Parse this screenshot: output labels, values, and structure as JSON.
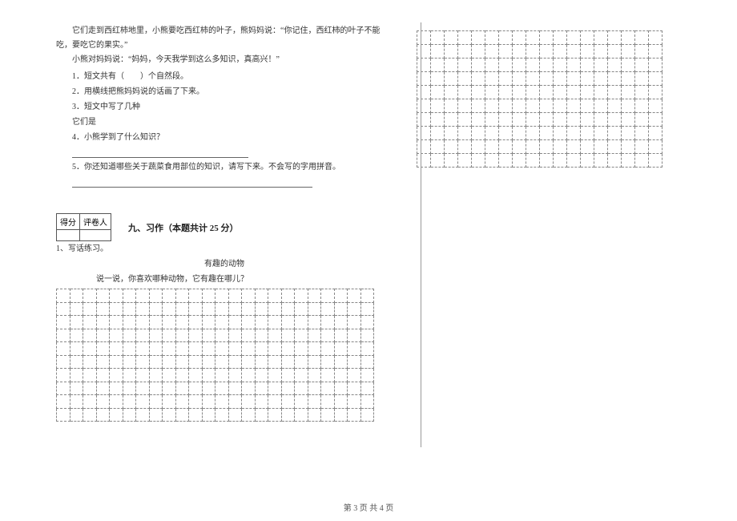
{
  "passage": {
    "p1": "它们走到西红柿地里，小熊要吃西红柿的叶子，熊妈妈说：“你记住，西红柿的叶子不能吃，要吃它的果实。”",
    "p2": "小熊对妈妈说：“妈妈，今天我学到这么多知识，真高兴！”"
  },
  "questions": {
    "q1": "1．短文共有（　　）个自然段。",
    "q2": "2．用横线把熊妈妈说的话画了下来。",
    "q3": "3．短文中写了几种",
    "q3b": "它们是",
    "q4": "4．小熊学到了什么知识？",
    "q5": "5．你还知道哪些关于蔬菜食用部位的知识，请写下来。不会写的字用拼音。"
  },
  "scorebox": {
    "h1": "得分",
    "h2": "评卷人"
  },
  "section9": {
    "title": "九、习作（本题共计 25 分）",
    "subq": "1、写话练习。",
    "essay_title": "有趣的动物",
    "prompt": "说一说，你喜欢哪种动物，它有趣在哪儿？"
  },
  "footer": "第 3 页 共 4 页",
  "grids": {
    "left": {
      "rows": 10,
      "cols": 24
    },
    "right": {
      "rows": 10,
      "cols": 18
    }
  }
}
